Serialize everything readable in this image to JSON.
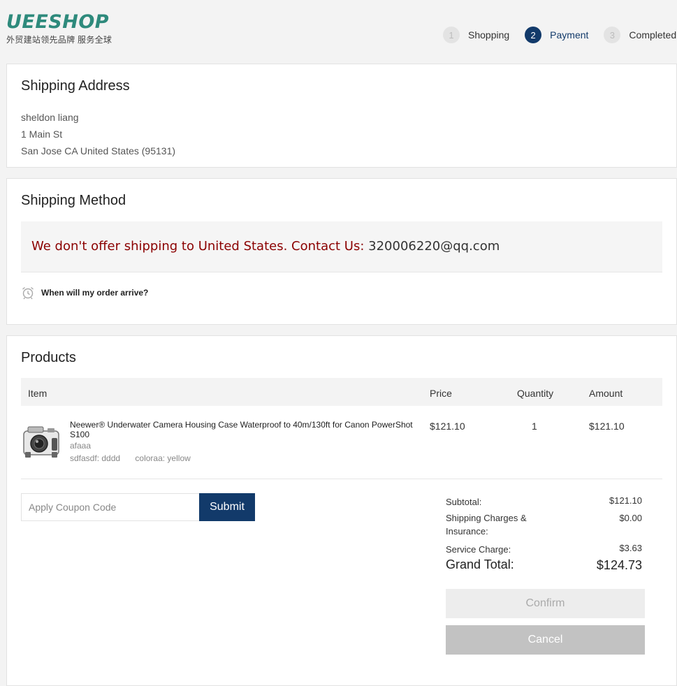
{
  "logo": {
    "brand": "UEESHOP",
    "tagline": "外贸建站领先品牌 服务全球"
  },
  "steps": [
    {
      "num": "1",
      "label": "Shopping",
      "active": false
    },
    {
      "num": "2",
      "label": "Payment",
      "active": true
    },
    {
      "num": "3",
      "label": "Completed",
      "active": false
    }
  ],
  "address": {
    "title": "Shipping Address",
    "name": "sheldon liang",
    "street": "1 Main St",
    "city_line": "San Jose CA United States (95131)"
  },
  "shipping_method": {
    "title": "Shipping Method",
    "notice": "We don't offer shipping to United States. Contact Us:",
    "email": "320006220@qq.com",
    "arrive_link": "When will my order arrive?"
  },
  "products": {
    "title": "Products",
    "columns": {
      "item": "Item",
      "price": "Price",
      "quantity": "Quantity",
      "amount": "Amount"
    },
    "items": [
      {
        "name": "Neewer® Underwater Camera Housing Case Waterproof to 40m/130ft for Canon PowerShot S100",
        "remark": "afaaa",
        "attr1": "sdfasdf: dddd",
        "attr2": "coloraa: yellow",
        "price": "$121.10",
        "quantity": "1",
        "amount": "$121.10"
      }
    ]
  },
  "coupon": {
    "placeholder": "Apply Coupon Code",
    "submit_label": "Submit"
  },
  "summary": {
    "subtotal_label": "Subtotal:",
    "subtotal": "$121.10",
    "shipping_label": "Shipping Charges & Insurance:",
    "shipping": "$0.00",
    "service_label": "Service Charge:",
    "service": "$3.63",
    "grand_label": "Grand Total:",
    "grand": "$124.73"
  },
  "actions": {
    "confirm": "Confirm",
    "cancel": "Cancel"
  },
  "colors": {
    "brand_green": "#2e8a7c",
    "navy": "#123a6a",
    "error_red": "#8b0000"
  }
}
